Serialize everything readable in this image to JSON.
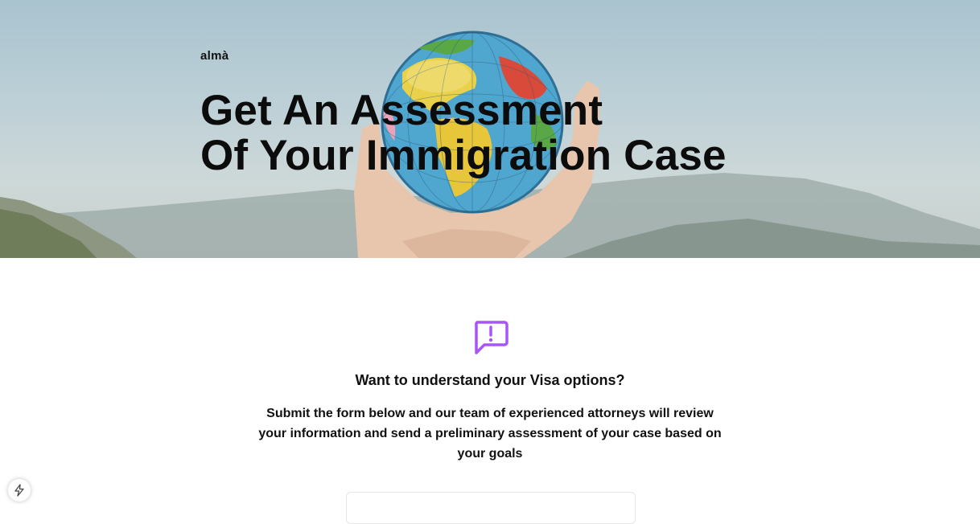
{
  "header": {
    "logo": "almà",
    "title_line1": "Get An Assessment",
    "title_line2": "Of Your Immigration Case"
  },
  "main": {
    "icon": "message-alert-icon",
    "heading": "Want to understand your Visa options?",
    "description": "Submit the form below and our team of experienced attorneys will review your information and send a preliminary assessment of your case based on your goals"
  },
  "floating": {
    "icon": "lightning-bolt-icon"
  },
  "colors": {
    "accent": "#a855f7",
    "sky": "#b5cbd3",
    "text": "#111111"
  }
}
